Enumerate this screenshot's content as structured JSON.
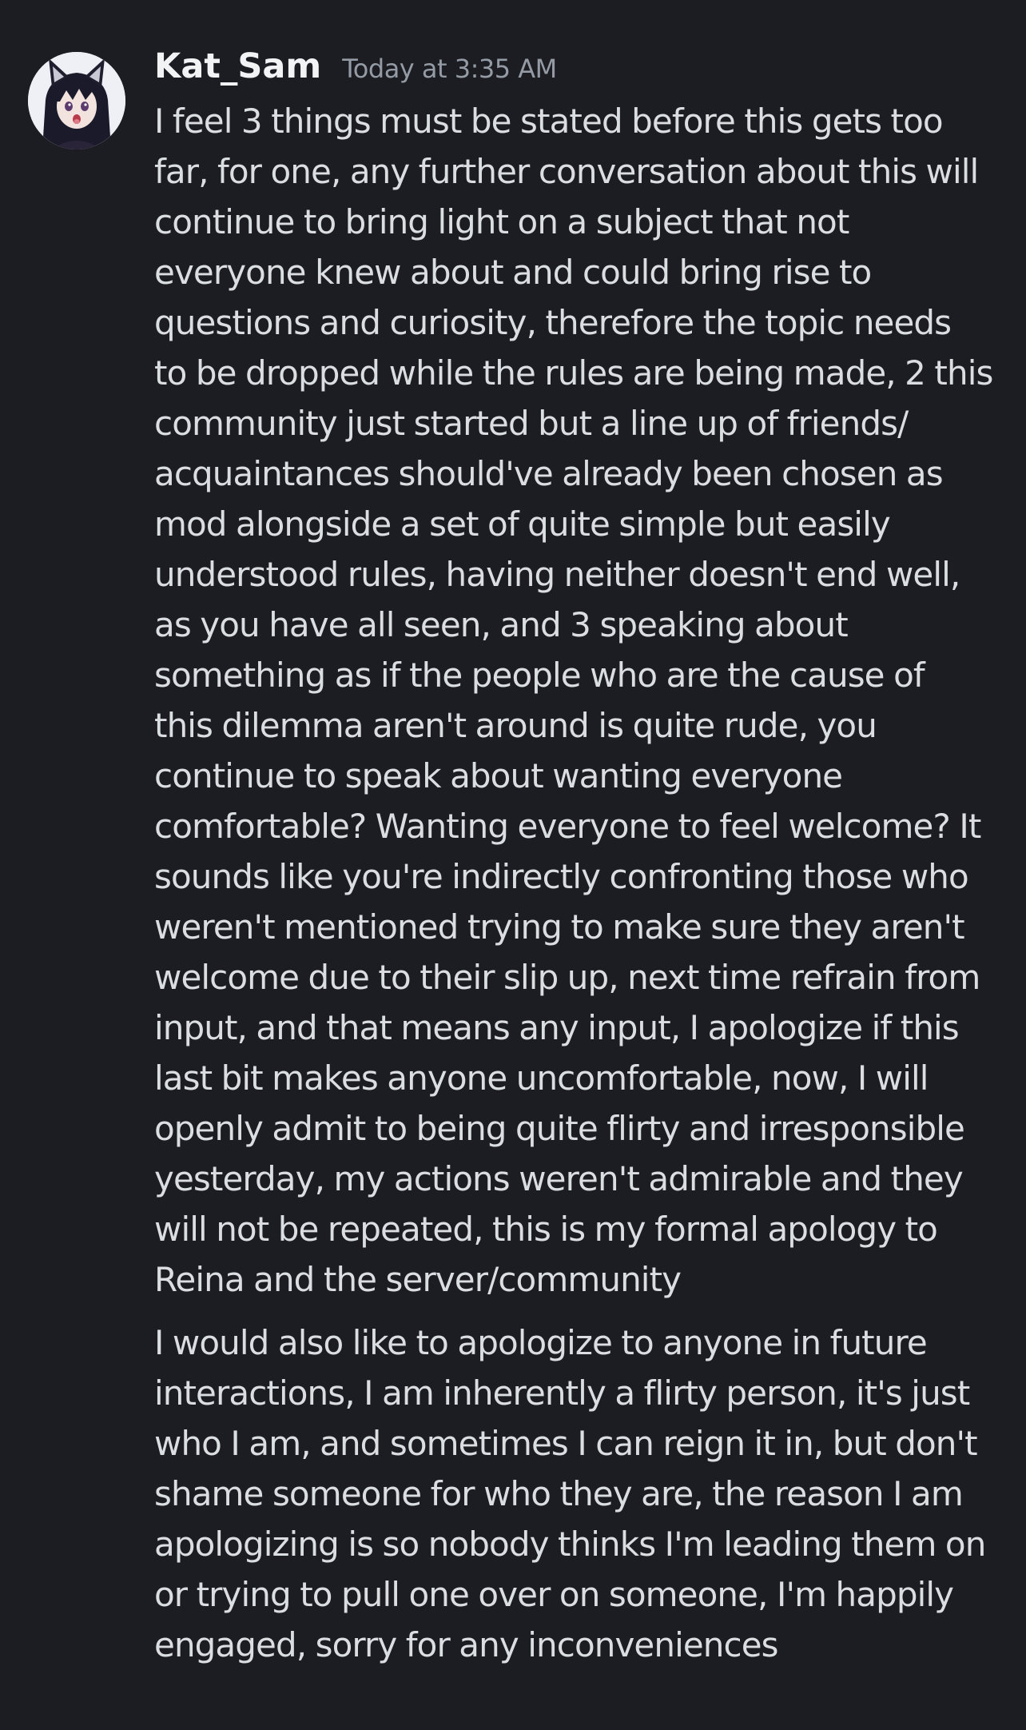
{
  "message": {
    "author": "Kat_Sam",
    "timestamp": "Today at 3:35 AM",
    "avatar_icon": "anime-girl-avatar-icon",
    "paragraphs": [
      {
        "lines": [
          "I feel 3 things must be stated before this gets too",
          "far, for one, any further conversation about this will",
          "continue to bring light on a subject that not",
          "everyone knew about and could bring rise to",
          "questions and curiosity, therefore the topic needs",
          "to be dropped while the rules are being made, 2 this",
          "community just started but a line up of friends/",
          "acquaintances should've already been chosen as",
          "mod alongside a set of quite simple but easily",
          "understood rules, having neither doesn't end well,",
          "as you have all seen, and 3 speaking about",
          "something as if the people who are the cause of",
          "this dilemma aren't around is quite rude, you",
          "continue to speak about wanting everyone",
          "comfortable? Wanting everyone to feel welcome? It",
          "sounds like you're indirectly confronting those who",
          "weren't mentioned trying to make sure they aren't",
          "welcome due to their slip up, next time refrain from",
          "input, and that means any input, I apologize if this",
          "last bit makes anyone uncomfortable, now, I will",
          "openly admit to being quite flirty and irresponsible",
          "yesterday, my actions weren't admirable and they",
          "will not be repeated, this is my formal apology to",
          "Reina and the server/community"
        ]
      },
      {
        "lines": [
          "I would also like to apologize to anyone in future",
          "interactions, I am inherently a flirty person, it's just",
          "who I am, and sometimes I can reign it in, but don't",
          "shame someone for who they are, the reason I am",
          "apologizing is so nobody thinks I'm leading them on",
          "or trying to pull one over on someone, I'm happily",
          "engaged, sorry for any inconveniences"
        ]
      }
    ]
  },
  "colors": {
    "background": "#1c1d22",
    "username": "#f2f3f5",
    "timestamp": "#949ba4",
    "message_text": "#dbdee1"
  }
}
